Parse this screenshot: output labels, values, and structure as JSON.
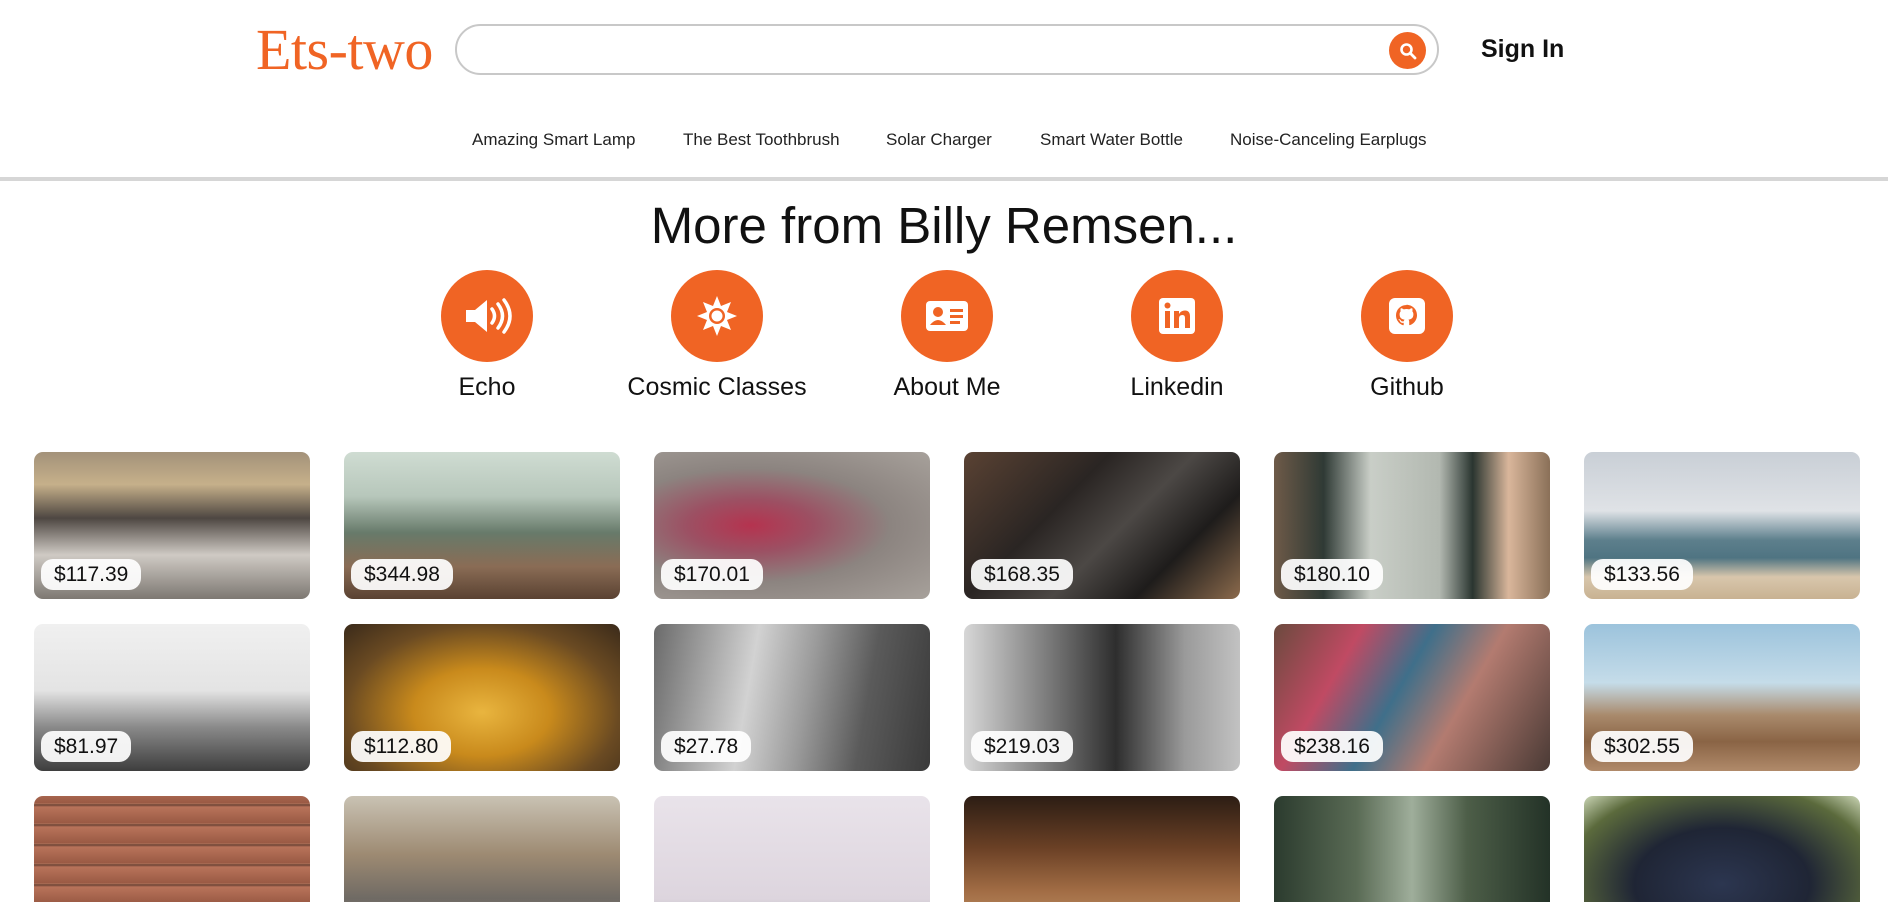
{
  "header": {
    "logo": "Ets-two",
    "search_placeholder": "",
    "sign_in": "Sign In"
  },
  "nav": [
    "Amazing Smart Lamp",
    "The Best Toothbrush",
    "Solar Charger",
    "Smart Water Bottle",
    "Noise-Canceling Earplugs"
  ],
  "more": {
    "title": "More from Billy Remsen...",
    "links": [
      {
        "label": "Echo",
        "icon": "speaker-icon"
      },
      {
        "label": "Cosmic Classes",
        "icon": "sun-icon"
      },
      {
        "label": "About Me",
        "icon": "id-card-icon"
      },
      {
        "label": "Linkedin",
        "icon": "linkedin-icon"
      },
      {
        "label": "Github",
        "icon": "github-icon"
      }
    ]
  },
  "colors": {
    "accent": "#f06424"
  },
  "products": [
    {
      "price": "$117.39",
      "image": "rocky-shore-waves"
    },
    {
      "price": "$344.98",
      "image": "volcano-landscape"
    },
    {
      "price": "$170.01",
      "image": "monkey-face-closeup"
    },
    {
      "price": "$168.35",
      "image": "vintage-cameras"
    },
    {
      "price": "$180.10",
      "image": "e-reader-in-hand"
    },
    {
      "price": "$133.56",
      "image": "ocean-beach"
    },
    {
      "price": "$81.97",
      "image": "skyscrapers-looking-up"
    },
    {
      "price": "$112.80",
      "image": "autumn-leaves"
    },
    {
      "price": "$27.78",
      "image": "misty-valley"
    },
    {
      "price": "$219.03",
      "image": "old-wagon-wheel"
    },
    {
      "price": "$238.16",
      "image": "woven-blanket"
    },
    {
      "price": "$302.55",
      "image": "desert-hills"
    },
    {
      "price": "",
      "image": "brick-wall"
    },
    {
      "price": "",
      "image": "train-station-crowd"
    },
    {
      "price": "",
      "image": "foggy-sky"
    },
    {
      "price": "",
      "image": "wooden-spoons"
    },
    {
      "price": "",
      "image": "forest-light"
    },
    {
      "price": "",
      "image": "grapes-on-vine"
    }
  ]
}
